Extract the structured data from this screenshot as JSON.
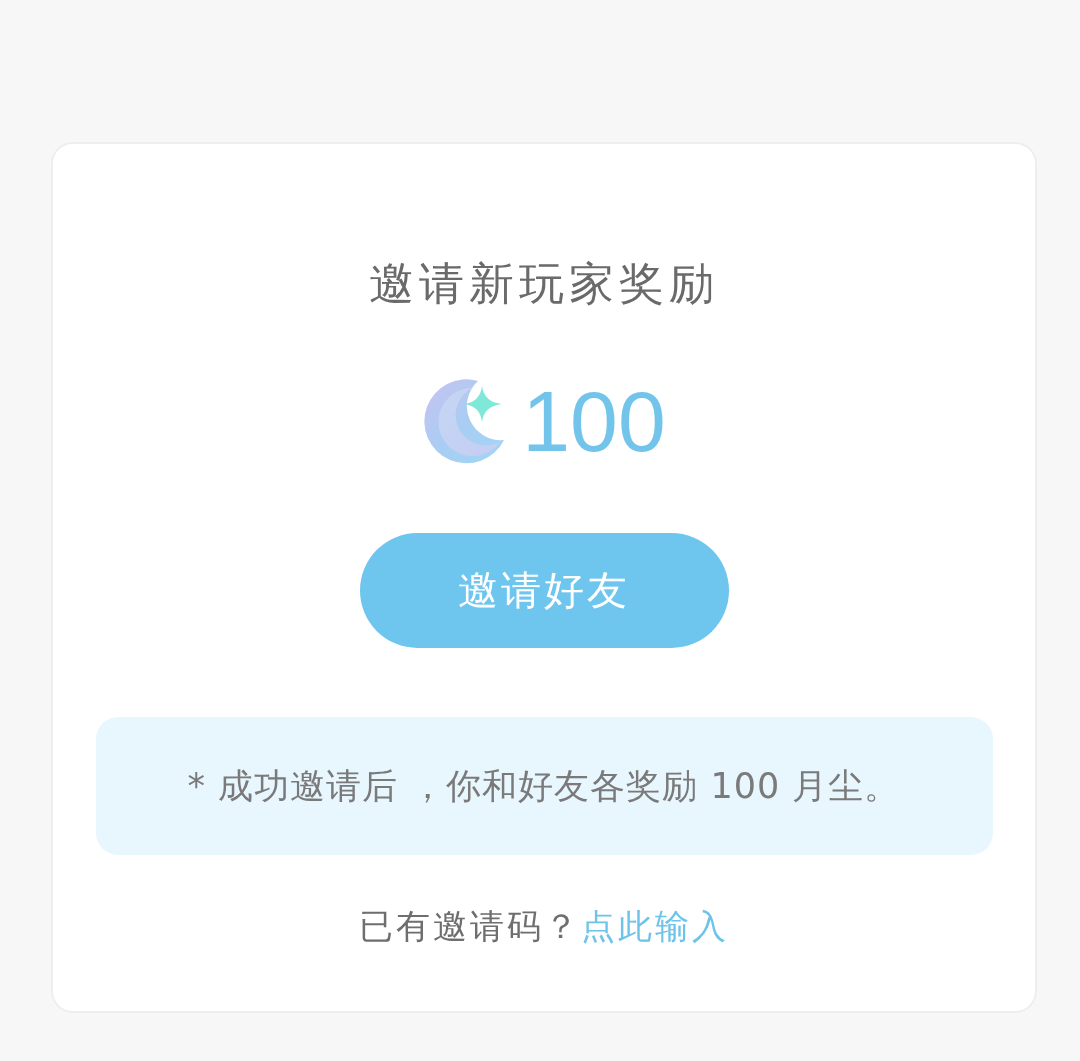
{
  "card": {
    "title": "邀请新玩家奖励",
    "reward": {
      "amount": "100"
    },
    "invite_button": {
      "label": "邀请好友"
    },
    "note": "* 成功邀请后 ，你和好友各奖励 100 月尘。",
    "code_prompt": {
      "text": "已有邀请码？",
      "link": "点此输入"
    }
  }
}
